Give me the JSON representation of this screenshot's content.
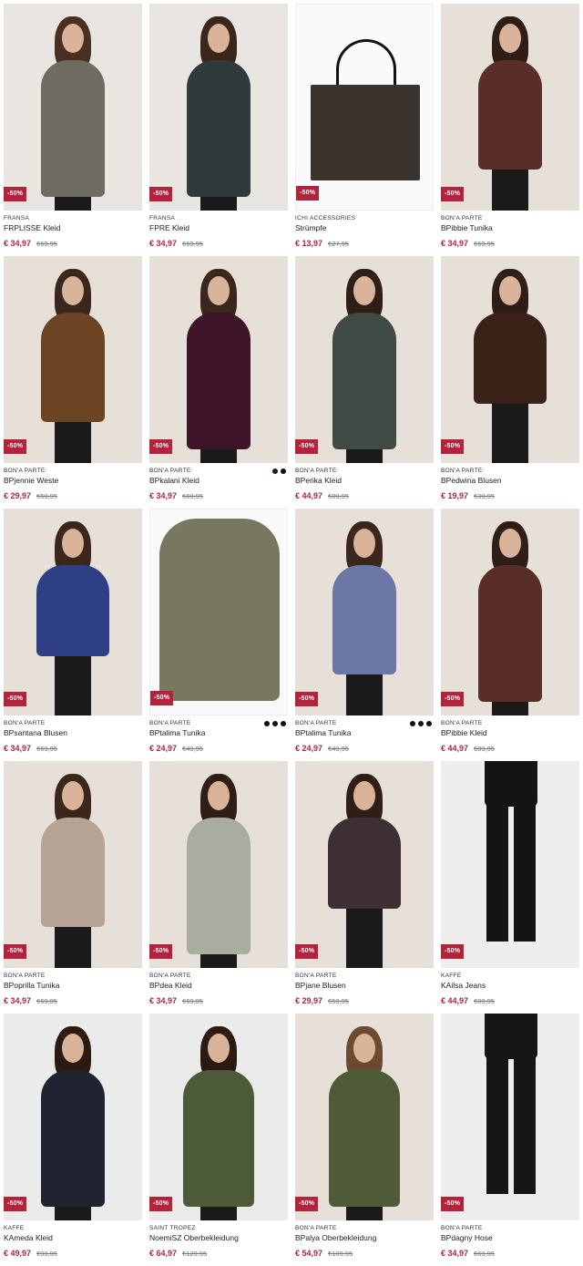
{
  "products": [
    {
      "brand": "FRANSA",
      "name": "FRPLISSE Kleid",
      "price": "€ 34,97",
      "old_price": "€69,95",
      "badge": "-50%",
      "swatches": 0,
      "bg": "#e9e6e1",
      "garment": "#6e6c61",
      "hair": "#4a3022",
      "style": "dress"
    },
    {
      "brand": "FRANSA",
      "name": "FPRE Kleid",
      "price": "€ 34,97",
      "old_price": "€69,95",
      "badge": "-50%",
      "swatches": 0,
      "bg": "#e9e6e1",
      "garment": "#2f3a3c",
      "hair": "#3a261b",
      "style": "dress"
    },
    {
      "brand": "ICHI ACCESSORIES",
      "name": "Strümpfe",
      "price": "€ 13,97",
      "old_price": "€27,95",
      "badge": "-50%",
      "swatches": 0,
      "bg": "#fafafa",
      "garment": "#3b332d",
      "hair": "",
      "style": "bag"
    },
    {
      "brand": "BON'A PARTE",
      "name": "BPibbie Tunika",
      "price": "€ 34,97",
      "old_price": "€69,95",
      "badge": "-50%",
      "swatches": 0,
      "bg": "#e7e0d8",
      "garment": "#5a2e28",
      "hair": "#2e1e16",
      "style": "tunic"
    },
    {
      "brand": "BON'A PARTE",
      "name": "BPjennie Weste",
      "price": "€ 29,97",
      "old_price": "€59,95",
      "badge": "-50%",
      "swatches": 0,
      "bg": "#e7e0d8",
      "garment": "#6b4424",
      "hair": "#3a261b",
      "style": "tunic"
    },
    {
      "brand": "BON'A PARTE",
      "name": "BPkalani Kleid",
      "price": "€ 34,97",
      "old_price": "€69,95",
      "badge": "-50%",
      "swatches": 2,
      "bg": "#e7e0d8",
      "garment": "#3d1428",
      "hair": "#3a261b",
      "style": "dress"
    },
    {
      "brand": "BON'A PARTE",
      "name": "BPerika Kleid",
      "price": "€ 44,97",
      "old_price": "€89,95",
      "badge": "-50%",
      "swatches": 0,
      "bg": "#e7e0d8",
      "garment": "#3f4a44",
      "hair": "#2e1e16",
      "style": "dress"
    },
    {
      "brand": "BON'A PARTE",
      "name": "BPedwina Blusen",
      "price": "€ 19,97",
      "old_price": "€39,95",
      "badge": "-50%",
      "swatches": 0,
      "bg": "#e7e0d8",
      "garment": "#3b2218",
      "hair": "#2e1e16",
      "style": "blouse"
    },
    {
      "brand": "BON'A PARTE",
      "name": "BPsantana Blusen",
      "price": "€ 34,97",
      "old_price": "€69,95",
      "badge": "-50%",
      "swatches": 0,
      "bg": "#e7e0d8",
      "garment": "#2f3f86",
      "hair": "#3a261b",
      "style": "blouse"
    },
    {
      "brand": "BON'A PARTE",
      "name": "BPtalima Tunika",
      "price": "€ 24,97",
      "old_price": "€49,95",
      "badge": "-50%",
      "swatches": 3,
      "bg": "#fafafa",
      "garment": "#7a7760",
      "hair": "",
      "style": "flat"
    },
    {
      "brand": "BON'A PARTE",
      "name": "BPtalima Tunika",
      "price": "€ 24,97",
      "old_price": "€49,95",
      "badge": "-50%",
      "swatches": 3,
      "bg": "#e7e0d8",
      "garment": "#6c77a8",
      "hair": "#3a261b",
      "style": "tunic"
    },
    {
      "brand": "BON'A PARTE",
      "name": "BPibbie Kleid",
      "price": "€ 44,97",
      "old_price": "€89,95",
      "badge": "-50%",
      "swatches": 0,
      "bg": "#e7e0d8",
      "garment": "#5a2e28",
      "hair": "#2e1e16",
      "style": "dress"
    },
    {
      "brand": "BON'A PARTE",
      "name": "BPoprilla Tunika",
      "price": "€ 34,97",
      "old_price": "€69,95",
      "badge": "-50%",
      "swatches": 0,
      "bg": "#e7e0d8",
      "garment": "#b7a495",
      "hair": "#3a261b",
      "style": "tunic"
    },
    {
      "brand": "BON'A PARTE",
      "name": "BPdea Kleid",
      "price": "€ 34,97",
      "old_price": "€69,95",
      "badge": "-50%",
      "swatches": 0,
      "bg": "#e7e0d8",
      "garment": "#a9ad9f",
      "hair": "#2e1e16",
      "style": "dress"
    },
    {
      "brand": "BON'A PARTE",
      "name": "BPjane Blusen",
      "price": "€ 29,97",
      "old_price": "€59,95",
      "badge": "-50%",
      "swatches": 0,
      "bg": "#e7e0d8",
      "garment": "#3d2f33",
      "hair": "#2e1e16",
      "style": "blouse"
    },
    {
      "brand": "KAFFE",
      "name": "KAilsa Jeans",
      "price": "€ 44,97",
      "old_price": "€89,95",
      "badge": "-50%",
      "swatches": 0,
      "bg": "#efeeec",
      "garment": "#141414",
      "hair": "",
      "style": "pants"
    },
    {
      "brand": "KAFFE",
      "name": "KAmeda Kleid",
      "price": "€ 49,97",
      "old_price": "€99,95",
      "badge": "-50%",
      "swatches": 0,
      "bg": "#ebebeb",
      "garment": "#1f2430",
      "hair": "#2a1a12",
      "style": "dress"
    },
    {
      "brand": "SAINT TROPEZ",
      "name": "NoemiSZ Oberbekleidung",
      "price": "€ 64,97",
      "old_price": "€129,95",
      "badge": "-50%",
      "swatches": 0,
      "bg": "#ebebeb",
      "garment": "#4d5a3a",
      "hair": "#2a1a12",
      "style": "coat"
    },
    {
      "brand": "BON'A PARTE",
      "name": "BPalya Oberbekleidung",
      "price": "€ 54,97",
      "old_price": "€109,95",
      "badge": "-50%",
      "swatches": 0,
      "bg": "#e7e0d8",
      "garment": "#4f5a36",
      "hair": "#6b4a30",
      "style": "coat"
    },
    {
      "brand": "BON'A PARTE",
      "name": "BPdagny Hose",
      "price": "€ 34,97",
      "old_price": "€69,95",
      "badge": "-50%",
      "swatches": 0,
      "bg": "#efeeec",
      "garment": "#151515",
      "hair": "",
      "style": "pants"
    }
  ]
}
